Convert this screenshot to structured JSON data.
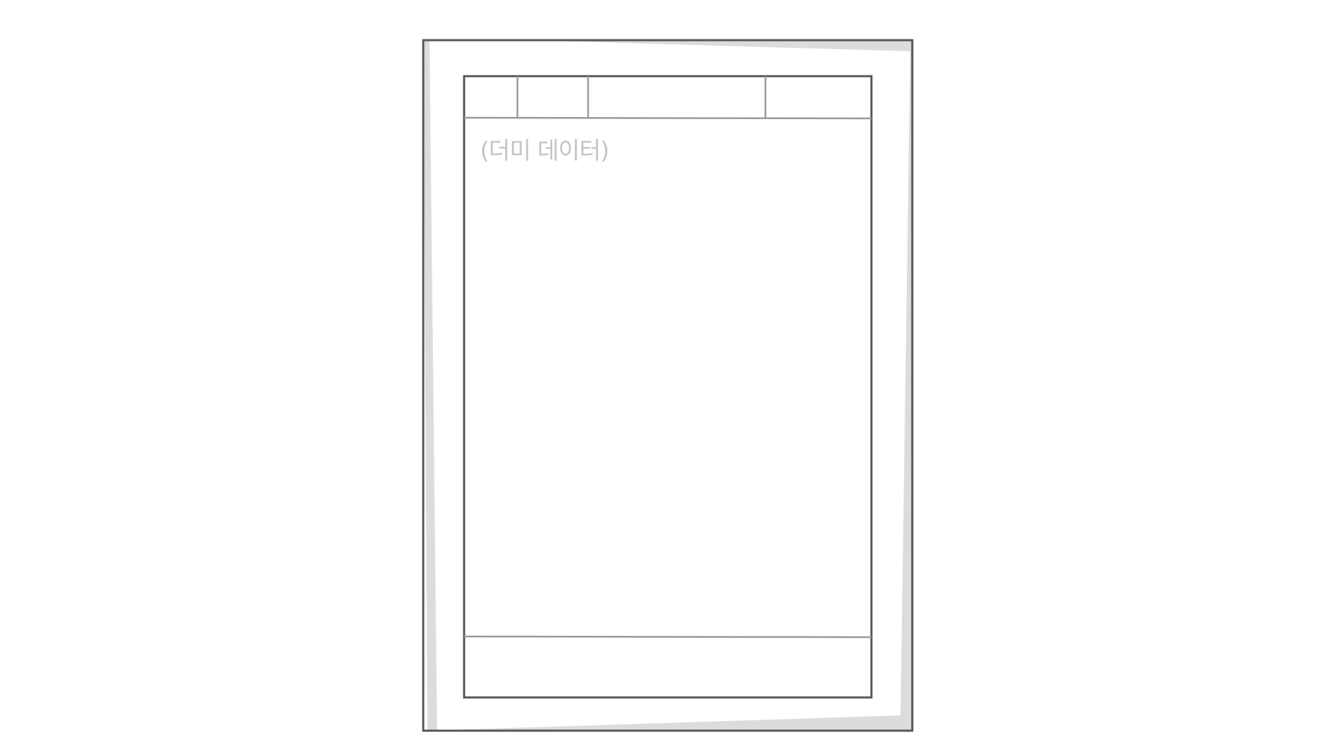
{
  "placeholder_text": "(더미 데이터)",
  "colors": {
    "background": "#ffffff",
    "frame_stroke": "#555555",
    "inner_stroke": "#999999",
    "paper_shadow": "#dcdcdc",
    "placeholder_text": "#c4c4c4"
  },
  "header_columns": 4
}
